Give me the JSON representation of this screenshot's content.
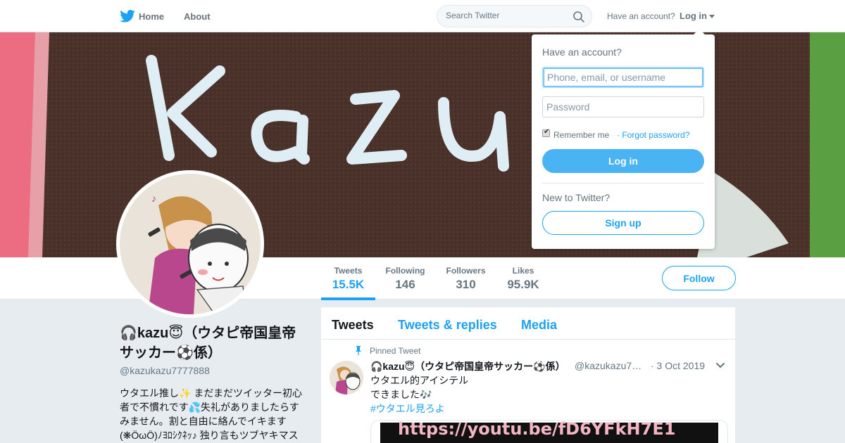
{
  "nav": {
    "home": "Home",
    "about": "About",
    "search_placeholder": "Search Twitter",
    "have_account": "Have an account?",
    "login": "Log in"
  },
  "banner": {
    "lettering": "Kazu"
  },
  "stats": [
    {
      "label": "Tweets",
      "value": "15.5K"
    },
    {
      "label": "Following",
      "value": "146"
    },
    {
      "label": "Followers",
      "value": "310"
    },
    {
      "label": "Likes",
      "value": "95.9K"
    }
  ],
  "follow_label": "Follow",
  "profile": {
    "name": "🎧kazu😇（ウタピ帝国皇帝サッカー⚽係）",
    "handle": "@kazukazu7777888",
    "bio": "ウタエル推し✨ まだまだツイッター初心者で不慣れです💦失礼がありましたらすみません。割と自由に絡んでイキます(❋ÖωÖ)ﾉﾖﾛｼｸﾈｯ♪ 独り言もツブヤキマス"
  },
  "timeline": {
    "tabs": [
      "Tweets",
      "Tweets & replies",
      "Media"
    ],
    "pinned_label": "Pinned Tweet",
    "tweet": {
      "name": "🎧kazu😇（ウタピ帝国皇帝サッカー⚽係）",
      "handle": "@kazukazu7…",
      "date": "· 3 Oct 2019",
      "line1": "ウタエル的アイシテル",
      "line2": "できました🎶",
      "hashtag": "#ウタエル見ろよ",
      "card_url": "https://youtu.be/fD6YFkH7E1"
    }
  },
  "login_dropdown": {
    "title": "Have an account?",
    "username_placeholder": "Phone, email, or username",
    "password_placeholder": "Password",
    "remember": "Remember me",
    "forgot": "· Forgot password?",
    "login_button": "Log in",
    "new_to_twitter": "New to Twitter?",
    "signup_button": "Sign up"
  },
  "colors": {
    "accent": "#1da1f2",
    "login_button": "#4ab3f4",
    "page_bg": "#e6ecf0"
  },
  "icons": [
    "twitter-bird-icon",
    "search-icon",
    "caret-down-icon",
    "pin-icon",
    "chevron-down-icon",
    "checkbox-checked-icon"
  ]
}
